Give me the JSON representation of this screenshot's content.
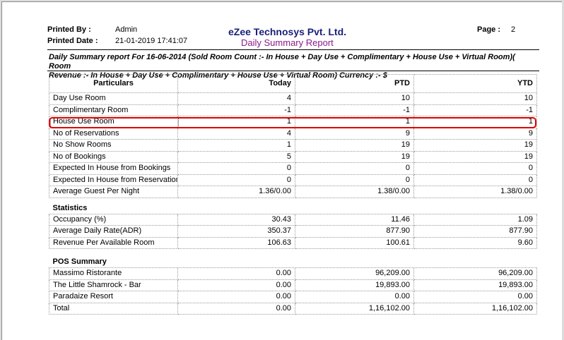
{
  "header": {
    "printed_by_label": "Printed By :",
    "printed_by_value": "Admin",
    "printed_date_label": "Printed Date :",
    "printed_date_value": "21-01-2019 17:41:07",
    "company": "eZee Technosys Pvt. Ltd.",
    "report_title": "Daily Summary Report",
    "page_label": "Page :",
    "page_value": "2"
  },
  "description_line1": "Daily Summary report For  16-06-2014 (Sold Room Count :- In House + Day Use + Complimentary + House Use + Virtual Room)( Room",
  "description_line2": "Revenue :- In House + Day Use + Complimentary + House Use + Virtual Room) Currency :- $",
  "columns": [
    "Particulars",
    "Today",
    "PTD",
    "YTD"
  ],
  "rooms": [
    [
      "Day Use Room",
      "4",
      "10",
      "10"
    ],
    [
      "Complimentary Room",
      "-1",
      "-1",
      "-1"
    ],
    [
      "House Use Room",
      "1",
      "1",
      "1"
    ],
    [
      "No of Reservations",
      "4",
      "9",
      "9"
    ],
    [
      "No Show Rooms",
      "1",
      "19",
      "19"
    ],
    [
      "No of Bookings",
      "5",
      "19",
      "19"
    ],
    [
      "Expected In House from Bookings",
      "0",
      "0",
      "0"
    ],
    [
      "Expected In House from Reservation",
      "0",
      "0",
      "0"
    ],
    [
      "Average Guest Per Night",
      "1.36/0.00",
      "1.38/0.00",
      "1.38/0.00"
    ]
  ],
  "statistics": {
    "title": "Statistics",
    "rows": [
      [
        "Occupancy (%)",
        "30.43",
        "11.46",
        "1.09"
      ],
      [
        "Average Daily Rate(ADR)",
        "350.37",
        "877.90",
        "877.90"
      ],
      [
        "Revenue Per Available Room",
        "106.63",
        "100.61",
        "9.60"
      ]
    ]
  },
  "pos": {
    "title": "POS Summary",
    "rows": [
      [
        "Massimo Ristorante",
        "0.00",
        "96,209.00",
        "96,209.00"
      ],
      [
        "The Little Shamrock - Bar",
        "0.00",
        "19,893.00",
        "19,893.00"
      ],
      [
        "Paradaize Resort",
        "0.00",
        "0.00",
        "0.00"
      ],
      [
        "Total",
        "0.00",
        "1,16,102.00",
        "1,16,102.00"
      ]
    ]
  }
}
